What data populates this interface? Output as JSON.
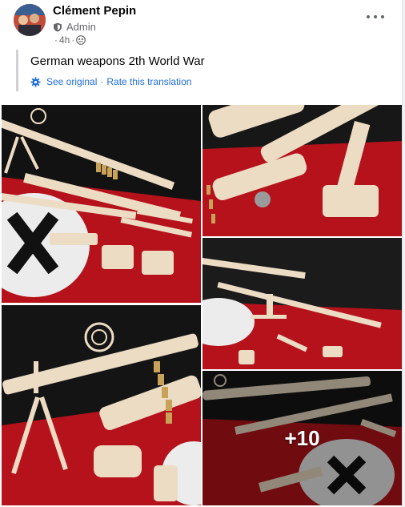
{
  "post": {
    "author": "Clément Pepin",
    "role": "Admin",
    "time": "4h",
    "text": "German weapons 2th World War",
    "see_original": "See original",
    "rate_translation": "Rate this translation",
    "more_photos": "+10"
  },
  "icons": {
    "role": "shield-icon",
    "audience": "group-members-icon",
    "translation": "gear-icon",
    "menu": "more-options-icon"
  },
  "colors": {
    "link": "#216fdb",
    "secondary_text": "#65676b",
    "flag_red": "#b5121b"
  }
}
